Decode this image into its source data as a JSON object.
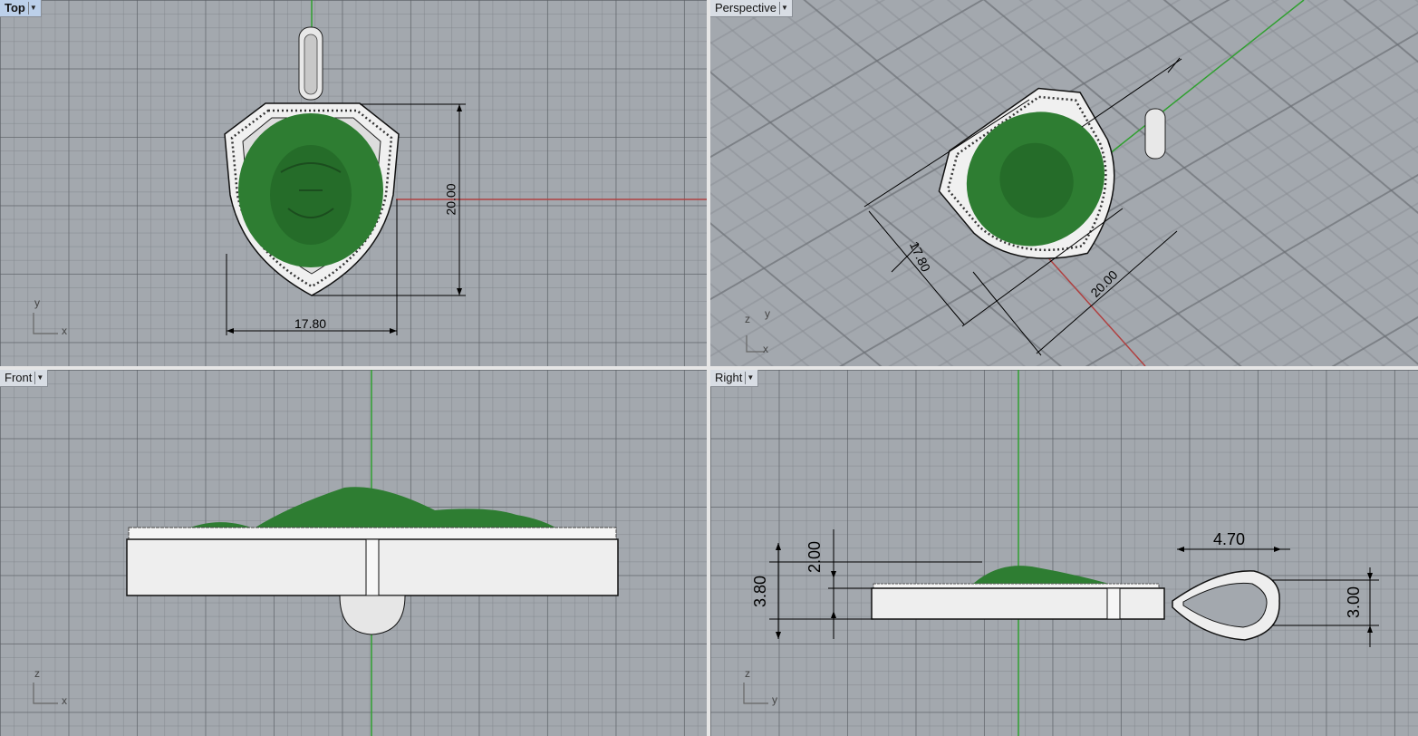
{
  "viewports": {
    "top": {
      "label": "Top",
      "dim_width": "17.80",
      "dim_height": "20.00",
      "axis_y": "y",
      "axis_x": "x"
    },
    "perspective": {
      "label": "Perspective",
      "dim_width": "17.80",
      "dim_height": "20.00",
      "axis_z": "z",
      "axis_y": "y",
      "axis_x": "x"
    },
    "front": {
      "label": "Front",
      "axis_z": "z",
      "axis_x": "x"
    },
    "right": {
      "label": "Right",
      "dim_depth": "2.00",
      "dim_total": "3.80",
      "dim_bail_length": "4.70",
      "dim_bail_height": "3.00",
      "axis_z": "z",
      "axis_y": "y"
    }
  },
  "colors": {
    "viewport_bg": "#a3a8ae",
    "model_green": "#2e7d32",
    "metal": "#e8e8e8",
    "axis_red": "#b04040",
    "axis_green": "#30a030"
  }
}
